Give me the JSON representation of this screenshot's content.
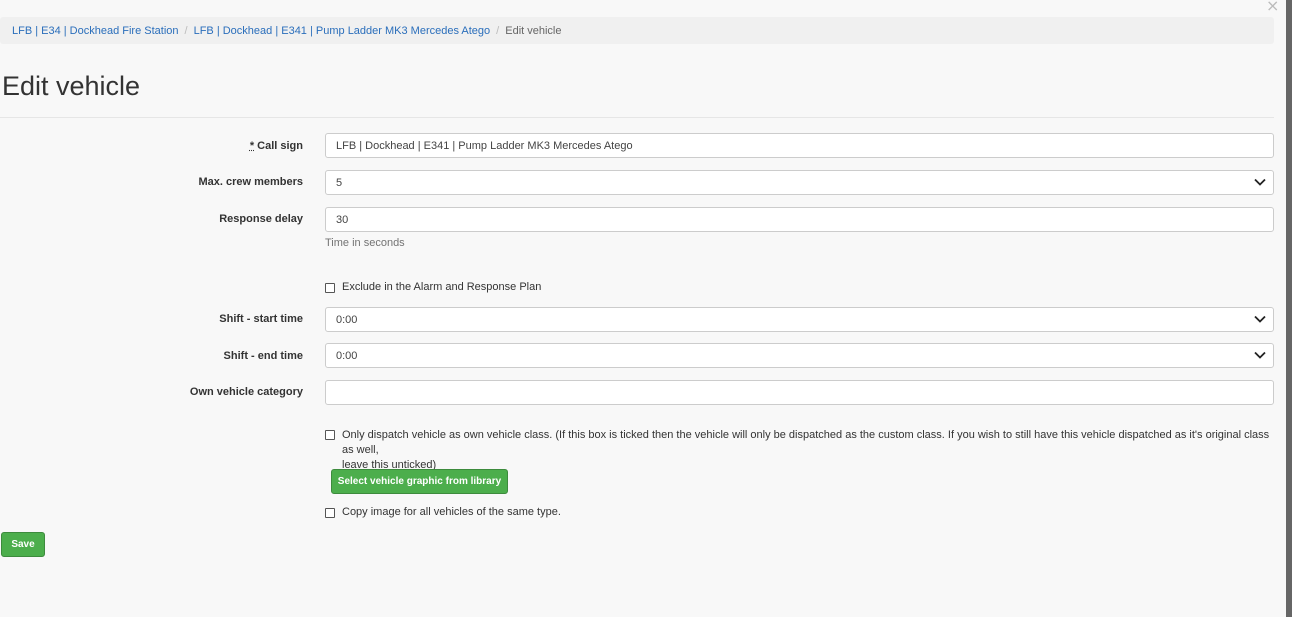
{
  "breadcrumb": {
    "item1": "LFB | E34 | Dockhead Fire Station",
    "item2": "LFB | Dockhead | E341 | Pump Ladder MK3 Mercedes Atego",
    "current": "Edit vehicle",
    "separator": "/"
  },
  "close_symbol": "×",
  "page_title": "Edit vehicle",
  "form": {
    "call_sign": {
      "required_mark": "*",
      "label": "Call sign",
      "value": "LFB | Dockhead | E341 | Pump Ladder MK3 Mercedes Atego"
    },
    "max_crew": {
      "label": "Max. crew members",
      "value": "5"
    },
    "response_delay": {
      "label": "Response delay",
      "value": "30",
      "help": "Time in seconds"
    },
    "exclude_checkbox": {
      "label": "Exclude in the Alarm and Response Plan",
      "checked": false
    },
    "shift_start": {
      "label": "Shift - start time",
      "value": "0:00"
    },
    "shift_end": {
      "label": "Shift - end time",
      "value": "0:00"
    },
    "own_category": {
      "label": "Own vehicle category",
      "value": ""
    },
    "only_dispatch_checkbox": {
      "label_line1": "Only dispatch vehicle as own vehicle class. (If this box is ticked then the vehicle will only be dispatched as the custom class. If you wish to still have this vehicle dispatched as it's original class as well,",
      "label_line2": "leave this unticked)",
      "checked": false
    },
    "select_graphic_button": "Select vehicle graphic from library",
    "copy_image_checkbox": {
      "label": "Copy image for all vehicles of the same type.",
      "checked": false
    },
    "save_button": "Save"
  },
  "colors": {
    "link": "#2a6ebb",
    "button_green": "#4cae4c",
    "background": "#f8f8f8"
  }
}
